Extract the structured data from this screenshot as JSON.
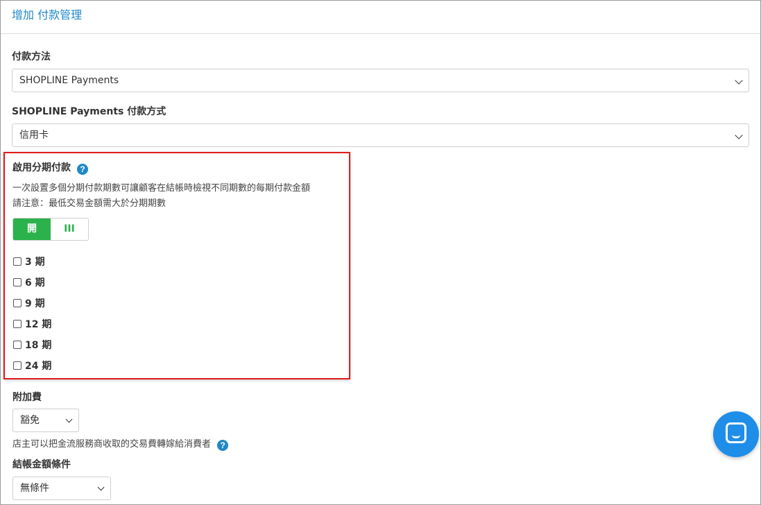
{
  "dialog": {
    "title": "增加 付款管理"
  },
  "payment_method": {
    "label": "付款方法",
    "selected": "SHOPLINE Payments"
  },
  "payment_type": {
    "label": "SHOPLINE Payments 付款方式",
    "selected": "信用卡"
  },
  "installment": {
    "label": "啟用分期付款",
    "help_icon": "?",
    "description_1": "一次設置多個分期付款期數可讓顧客在結帳時檢視不同期數的每期付款金額",
    "description_2": "請注意：最低交易金額需大於分期期數",
    "toggle_on_label": "開",
    "toggle_off_label": "III",
    "options": [
      {
        "label": "3 期"
      },
      {
        "label": "6 期"
      },
      {
        "label": "9 期"
      },
      {
        "label": "12 期"
      },
      {
        "label": "18 期"
      },
      {
        "label": "24 期"
      }
    ]
  },
  "surcharge": {
    "label": "附加費",
    "selected": "豁免",
    "note": "店主可以把金流服務商收取的交易費轉嫁給消費者",
    "help_icon": "?"
  },
  "checkout_condition": {
    "label": "結帳金額條件",
    "selected": "無條件"
  },
  "colors": {
    "accent": "#1e88c8",
    "toggle_green": "#2bb24c",
    "highlight_red": "#e01b1b",
    "chat_blue": "#1e8ee8"
  },
  "icons": {
    "help": "question-circle-icon",
    "chat": "chat-icon",
    "dropdown": "chevron-down-icon"
  }
}
